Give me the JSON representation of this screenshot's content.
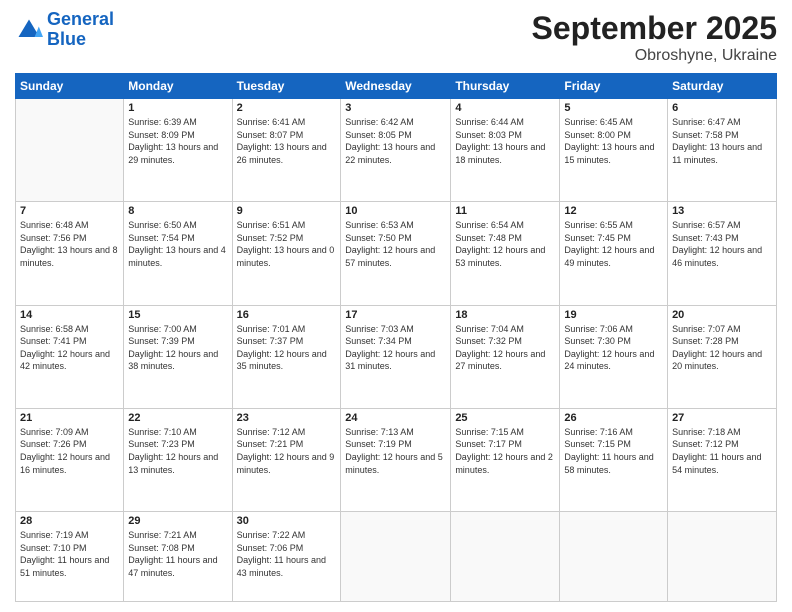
{
  "header": {
    "logo_line1": "General",
    "logo_line2": "Blue",
    "month": "September 2025",
    "location": "Obroshyne, Ukraine"
  },
  "weekdays": [
    "Sunday",
    "Monday",
    "Tuesday",
    "Wednesday",
    "Thursday",
    "Friday",
    "Saturday"
  ],
  "weeks": [
    [
      {
        "day": null
      },
      {
        "day": "1",
        "sunrise": "6:39 AM",
        "sunset": "8:09 PM",
        "daylight": "13 hours and 29 minutes."
      },
      {
        "day": "2",
        "sunrise": "6:41 AM",
        "sunset": "8:07 PM",
        "daylight": "13 hours and 26 minutes."
      },
      {
        "day": "3",
        "sunrise": "6:42 AM",
        "sunset": "8:05 PM",
        "daylight": "13 hours and 22 minutes."
      },
      {
        "day": "4",
        "sunrise": "6:44 AM",
        "sunset": "8:03 PM",
        "daylight": "13 hours and 18 minutes."
      },
      {
        "day": "5",
        "sunrise": "6:45 AM",
        "sunset": "8:00 PM",
        "daylight": "13 hours and 15 minutes."
      },
      {
        "day": "6",
        "sunrise": "6:47 AM",
        "sunset": "7:58 PM",
        "daylight": "13 hours and 11 minutes."
      }
    ],
    [
      {
        "day": "7",
        "sunrise": "6:48 AM",
        "sunset": "7:56 PM",
        "daylight": "13 hours and 8 minutes."
      },
      {
        "day": "8",
        "sunrise": "6:50 AM",
        "sunset": "7:54 PM",
        "daylight": "13 hours and 4 minutes."
      },
      {
        "day": "9",
        "sunrise": "6:51 AM",
        "sunset": "7:52 PM",
        "daylight": "13 hours and 0 minutes."
      },
      {
        "day": "10",
        "sunrise": "6:53 AM",
        "sunset": "7:50 PM",
        "daylight": "12 hours and 57 minutes."
      },
      {
        "day": "11",
        "sunrise": "6:54 AM",
        "sunset": "7:48 PM",
        "daylight": "12 hours and 53 minutes."
      },
      {
        "day": "12",
        "sunrise": "6:55 AM",
        "sunset": "7:45 PM",
        "daylight": "12 hours and 49 minutes."
      },
      {
        "day": "13",
        "sunrise": "6:57 AM",
        "sunset": "7:43 PM",
        "daylight": "12 hours and 46 minutes."
      }
    ],
    [
      {
        "day": "14",
        "sunrise": "6:58 AM",
        "sunset": "7:41 PM",
        "daylight": "12 hours and 42 minutes."
      },
      {
        "day": "15",
        "sunrise": "7:00 AM",
        "sunset": "7:39 PM",
        "daylight": "12 hours and 38 minutes."
      },
      {
        "day": "16",
        "sunrise": "7:01 AM",
        "sunset": "7:37 PM",
        "daylight": "12 hours and 35 minutes."
      },
      {
        "day": "17",
        "sunrise": "7:03 AM",
        "sunset": "7:34 PM",
        "daylight": "12 hours and 31 minutes."
      },
      {
        "day": "18",
        "sunrise": "7:04 AM",
        "sunset": "7:32 PM",
        "daylight": "12 hours and 27 minutes."
      },
      {
        "day": "19",
        "sunrise": "7:06 AM",
        "sunset": "7:30 PM",
        "daylight": "12 hours and 24 minutes."
      },
      {
        "day": "20",
        "sunrise": "7:07 AM",
        "sunset": "7:28 PM",
        "daylight": "12 hours and 20 minutes."
      }
    ],
    [
      {
        "day": "21",
        "sunrise": "7:09 AM",
        "sunset": "7:26 PM",
        "daylight": "12 hours and 16 minutes."
      },
      {
        "day": "22",
        "sunrise": "7:10 AM",
        "sunset": "7:23 PM",
        "daylight": "12 hours and 13 minutes."
      },
      {
        "day": "23",
        "sunrise": "7:12 AM",
        "sunset": "7:21 PM",
        "daylight": "12 hours and 9 minutes."
      },
      {
        "day": "24",
        "sunrise": "7:13 AM",
        "sunset": "7:19 PM",
        "daylight": "12 hours and 5 minutes."
      },
      {
        "day": "25",
        "sunrise": "7:15 AM",
        "sunset": "7:17 PM",
        "daylight": "12 hours and 2 minutes."
      },
      {
        "day": "26",
        "sunrise": "7:16 AM",
        "sunset": "7:15 PM",
        "daylight": "11 hours and 58 minutes."
      },
      {
        "day": "27",
        "sunrise": "7:18 AM",
        "sunset": "7:12 PM",
        "daylight": "11 hours and 54 minutes."
      }
    ],
    [
      {
        "day": "28",
        "sunrise": "7:19 AM",
        "sunset": "7:10 PM",
        "daylight": "11 hours and 51 minutes."
      },
      {
        "day": "29",
        "sunrise": "7:21 AM",
        "sunset": "7:08 PM",
        "daylight": "11 hours and 47 minutes."
      },
      {
        "day": "30",
        "sunrise": "7:22 AM",
        "sunset": "7:06 PM",
        "daylight": "11 hours and 43 minutes."
      },
      {
        "day": null
      },
      {
        "day": null
      },
      {
        "day": null
      },
      {
        "day": null
      }
    ]
  ]
}
